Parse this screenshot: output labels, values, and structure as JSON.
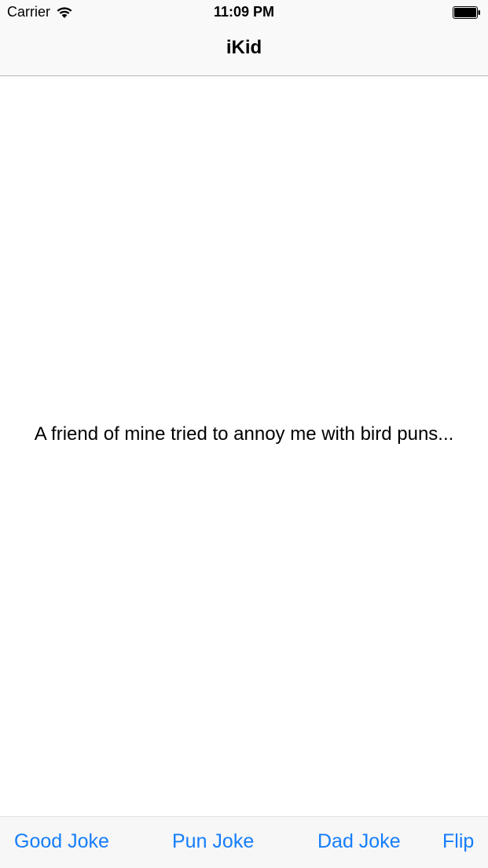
{
  "status_bar": {
    "carrier": "Carrier",
    "time": "11:09 PM",
    "wifi_icon": "wifi-icon",
    "battery_icon": "battery-icon"
  },
  "nav": {
    "title": "iKid"
  },
  "content": {
    "joke": "A friend of mine tried to annoy me with bird puns..."
  },
  "toolbar": {
    "good_joke": "Good Joke",
    "pun_joke": "Pun Joke",
    "dad_joke": "Dad Joke",
    "flip": "Flip"
  },
  "colors": {
    "tint": "#157efb",
    "bar_background": "#f9f9f9"
  }
}
